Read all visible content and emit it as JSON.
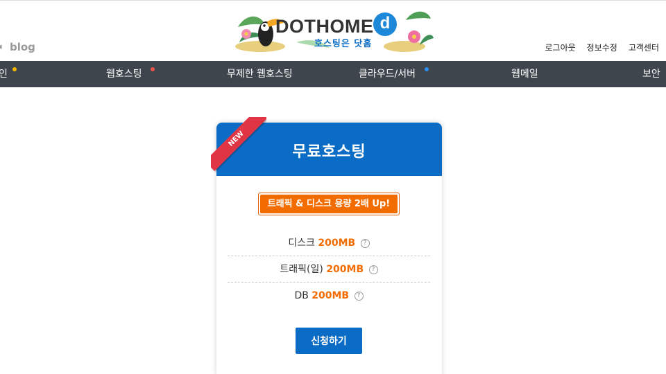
{
  "header": {
    "blog_link": "blog",
    "logo_text": "DOTHOME",
    "logo_d": "d",
    "logo_sub": "호스팅은 닷홈",
    "top_links": [
      "로그아웃",
      "정보수정",
      "고객센터"
    ]
  },
  "nav": {
    "items": [
      {
        "label": "인",
        "dot": "#f5b400"
      },
      {
        "label": "웹호스팅",
        "dot": "#e8534a"
      },
      {
        "label": "무제한 웹호스팅",
        "dot": null
      },
      {
        "label": "클라우드/서버",
        "dot": "#2b8ef0"
      },
      {
        "label": "웹메일",
        "dot": null
      },
      {
        "label": "보안",
        "dot": null
      }
    ]
  },
  "card": {
    "ribbon": "NEW",
    "title": "무료호스팅",
    "promo": "트래픽 & 디스크 용량 2배 Up!",
    "specs": [
      {
        "label": "디스크",
        "value": "200MB"
      },
      {
        "label": "트래픽(일)",
        "value": "200MB"
      },
      {
        "label": "DB",
        "value": "200MB"
      }
    ],
    "apply_button": "신청하기"
  },
  "colors": {
    "brand_blue": "#0a6cc4",
    "accent_orange": "#f26c00",
    "nav_bg": "#3e454c",
    "ribbon_red": "#e03545"
  }
}
